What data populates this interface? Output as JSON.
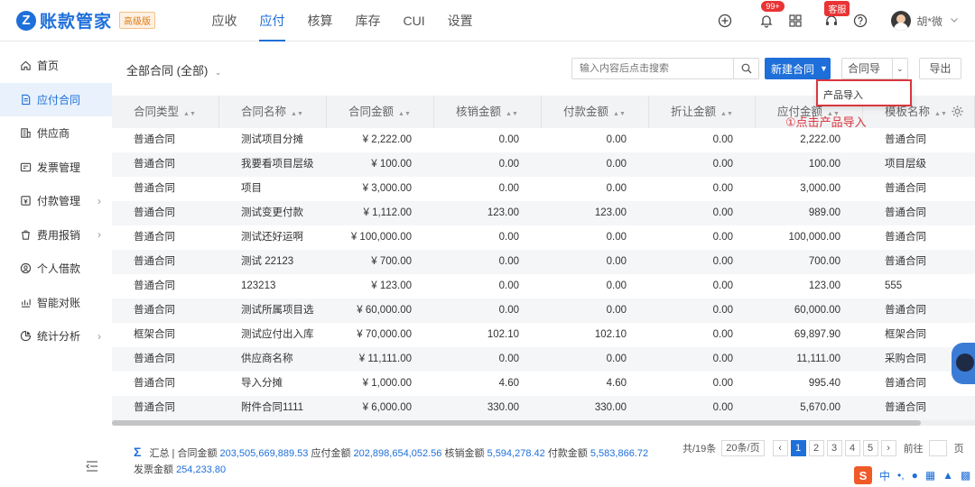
{
  "app": {
    "logo_letter": "Z",
    "name": "账款管家",
    "edition": "高级版"
  },
  "topnav": [
    {
      "label": "应收",
      "active": false
    },
    {
      "label": "应付",
      "active": true
    },
    {
      "label": "核算",
      "active": false
    },
    {
      "label": "库存",
      "active": false
    },
    {
      "label": "CUI",
      "active": false
    },
    {
      "label": "设置",
      "active": false
    }
  ],
  "topright": {
    "notif_count": "99+",
    "kefu_label": "客服",
    "user_name": "胡*微"
  },
  "sidebar": {
    "items": [
      {
        "label": "首页",
        "icon": "home-icon",
        "active": false,
        "has_children": false
      },
      {
        "label": "应付合同",
        "icon": "document-icon",
        "active": true,
        "has_children": false
      },
      {
        "label": "供应商",
        "icon": "building-icon",
        "active": false,
        "has_children": false
      },
      {
        "label": "发票管理",
        "icon": "invoice-icon",
        "active": false,
        "has_children": false
      },
      {
        "label": "付款管理",
        "icon": "payment-icon",
        "active": false,
        "has_children": true
      },
      {
        "label": "费用报销",
        "icon": "expense-icon",
        "active": false,
        "has_children": true
      },
      {
        "label": "个人借款",
        "icon": "loan-icon",
        "active": false,
        "has_children": false
      },
      {
        "label": "智能对账",
        "icon": "reconcile-icon",
        "active": false,
        "has_children": false
      },
      {
        "label": "统计分析",
        "icon": "chart-icon",
        "active": false,
        "has_children": true
      }
    ]
  },
  "toolbar": {
    "filter_label": "全部合同 (全部)",
    "search_placeholder": "输入内容后点击搜索",
    "new_contract": "新建合同",
    "import_label": "合同导入",
    "export_label": "导出",
    "dropdown_option": "产品导入",
    "annotation": "①点击产品导入"
  },
  "table": {
    "columns": [
      "合同类型",
      "合同名称",
      "合同金额",
      "核销金额",
      "付款金额",
      "折让金额",
      "应付金额",
      "模板名称"
    ],
    "rows": [
      [
        "普通合同",
        "测试项目分摊",
        "¥ 2,222.00",
        "0.00",
        "0.00",
        "0.00",
        "2,222.00",
        "普通合同"
      ],
      [
        "普通合同",
        "我要看项目层级",
        "¥ 100.00",
        "0.00",
        "0.00",
        "0.00",
        "100.00",
        "项目层级"
      ],
      [
        "普通合同",
        "项目",
        "¥ 3,000.00",
        "0.00",
        "0.00",
        "0.00",
        "3,000.00",
        "普通合同"
      ],
      [
        "普通合同",
        "测试变更付款",
        "¥ 1,112.00",
        "123.00",
        "123.00",
        "0.00",
        "989.00",
        "普通合同"
      ],
      [
        "普通合同",
        "测试还好运啊",
        "¥ 100,000.00",
        "0.00",
        "0.00",
        "0.00",
        "100,000.00",
        "普通合同"
      ],
      [
        "普通合同",
        "测试 22123",
        "¥ 700.00",
        "0.00",
        "0.00",
        "0.00",
        "700.00",
        "普通合同"
      ],
      [
        "普通合同",
        "123213",
        "¥ 123.00",
        "0.00",
        "0.00",
        "0.00",
        "123.00",
        "555"
      ],
      [
        "普通合同",
        "测试所属项目选",
        "¥ 60,000.00",
        "0.00",
        "0.00",
        "0.00",
        "60,000.00",
        "普通合同"
      ],
      [
        "框架合同",
        "测试应付出入库",
        "¥ 70,000.00",
        "102.10",
        "102.10",
        "0.00",
        "69,897.90",
        "框架合同"
      ],
      [
        "普通合同",
        "供应商名称",
        "¥ 11,111.00",
        "0.00",
        "0.00",
        "0.00",
        "11,111.00",
        "采购合同"
      ],
      [
        "普通合同",
        "导入分摊",
        "¥ 1,000.00",
        "4.60",
        "4.60",
        "0.00",
        "995.40",
        "普通合同"
      ],
      [
        "普通合同",
        "附件合同1111",
        "¥ 6,000.00",
        "330.00",
        "330.00",
        "0.00",
        "5,670.00",
        "普通合同"
      ]
    ]
  },
  "summary": {
    "prefix": "汇总 |",
    "contract_label": "合同金额",
    "contract_value": "203,505,669,889.53",
    "payable_label": "应付金额",
    "payable_value": "202,898,654,052.56",
    "writeoff_label": "核销金额",
    "writeoff_value": "5,594,278.42",
    "paid_label": "付款金额",
    "paid_value": "5,583,866.72",
    "invoice_label": "发票金额",
    "invoice_value": "254,233.80"
  },
  "pager": {
    "total_text": "共/19条",
    "page_size": "20条/页",
    "pages": [
      "1",
      "2",
      "3",
      "4",
      "5"
    ],
    "current": "1",
    "goto_label": "前往",
    "page_unit": "页"
  },
  "ime": {
    "logo": "S",
    "lang": "中"
  },
  "colors": {
    "primary": "#1e6fd9",
    "annotation": "#d9363e",
    "badge": "#e83434"
  }
}
